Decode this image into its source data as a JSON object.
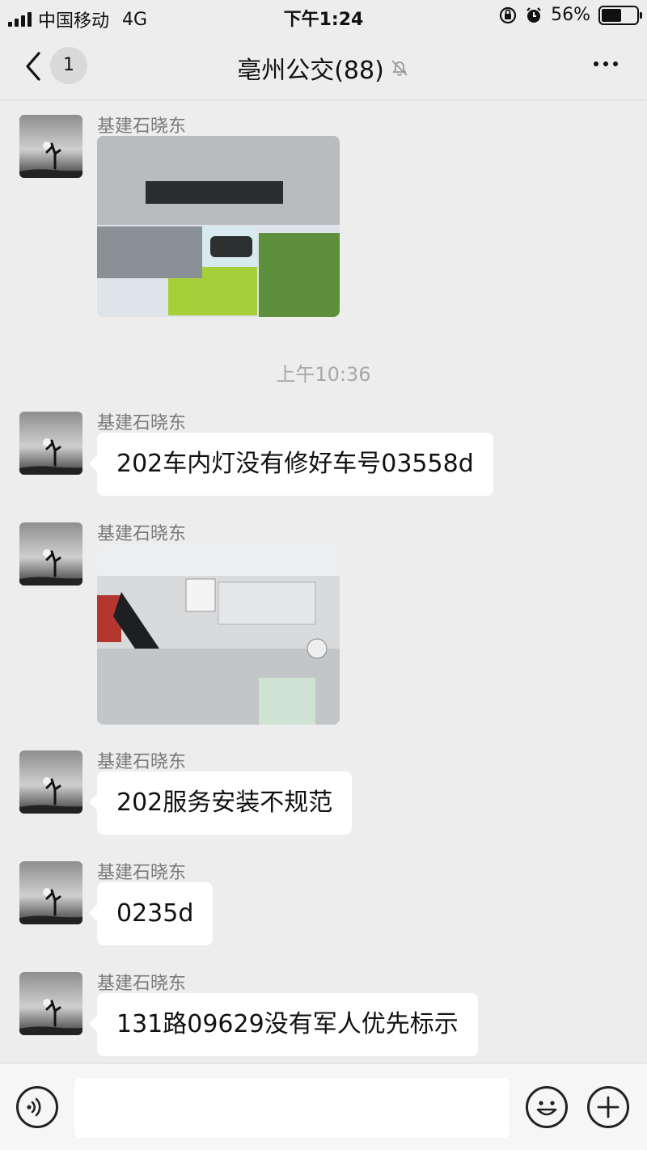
{
  "status_bar": {
    "carrier": "中国移动",
    "network": "4G",
    "time": "下午1:24",
    "battery_percent": "56%",
    "battery_level": 0.56
  },
  "nav": {
    "unread_count": "1",
    "title": "亳州公交(88)",
    "muted_icon": "bell-slash-icon",
    "more_icon": "more-dots-icon"
  },
  "timestamp": "上午10:36",
  "messages": [
    {
      "sender": "基建石晓东",
      "type": "image"
    },
    {
      "sender": "基建石晓东",
      "type": "text",
      "text": "202车内灯没有修好车号03558d"
    },
    {
      "sender": "基建石晓东",
      "type": "image"
    },
    {
      "sender": "基建石晓东",
      "type": "text",
      "text": "202服务安装不规范"
    },
    {
      "sender": "基建石晓东",
      "type": "text",
      "text": "0235d"
    },
    {
      "sender": "基建石晓东",
      "type": "text",
      "text": "131路09629没有军人优先标示"
    }
  ],
  "input_bar": {
    "voice_icon": "voice-icon",
    "emoji_icon": "emoji-icon",
    "plus_icon": "plus-icon",
    "text_value": ""
  },
  "colors": {
    "background": "#ededed",
    "bubble": "#ffffff",
    "sender_text": "#7a7a7a",
    "timestamp_text": "#a8a8a8"
  }
}
